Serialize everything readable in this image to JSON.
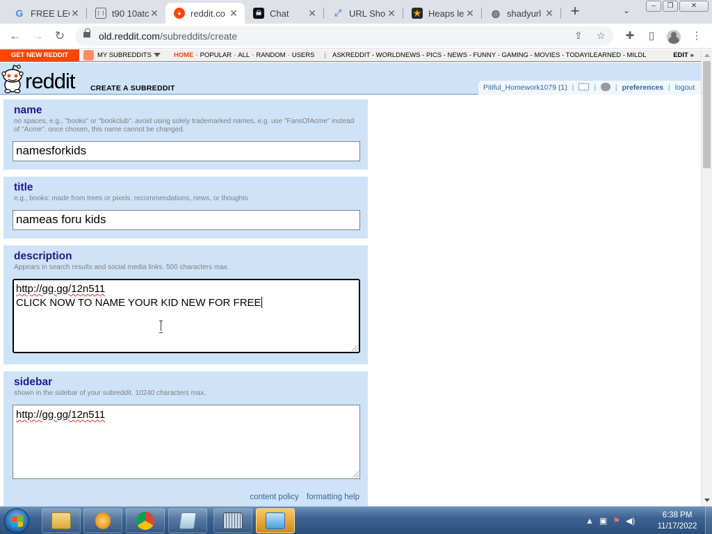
{
  "browser": {
    "tabs": [
      {
        "title": "FREE LEG",
        "favicon": "google-g"
      },
      {
        "title": "t90 10atc",
        "favicon": "generic-page"
      },
      {
        "title": "reddit.co",
        "favicon": "reddit-alien",
        "active": true
      },
      {
        "title": "Chat",
        "favicon": "pirate-flag"
      },
      {
        "title": "URL Shor",
        "favicon": "link"
      },
      {
        "title": "Heaps le",
        "favicon": "star"
      },
      {
        "title": "shadyurl",
        "favicon": "globe"
      }
    ],
    "url_domain": "old.reddit.com",
    "url_path": "/subreddits/create"
  },
  "reddit": {
    "srbar": {
      "get_new": "GET NEW REDDIT",
      "my_subreddits": "MY SUBREDDITS",
      "nav": [
        "HOME",
        "POPULAR",
        "ALL",
        "RANDOM",
        "USERS"
      ],
      "subs": "ASKREDDIT - WORLDNEWS - PICS - NEWS - FUNNY - GAMING - MOVIES - TODAYILEARNED - MILDL",
      "edit": "EDIT »"
    },
    "header": {
      "wordmark": "reddit",
      "pagename": "CREATE A SUBREDDIT",
      "username": "Pitiful_Homework1079",
      "karma": "(1)",
      "preferences": "preferences",
      "logout": "logout"
    },
    "form": {
      "name": {
        "label": "name",
        "hint": "no spaces, e.g., \"books\" or \"bookclub\". avoid using solely trademarked names, e.g. use \"FansOfAcme\" instead of \"Acme\". once chosen, this name cannot be changed.",
        "value": "namesforkids"
      },
      "title": {
        "label": "title",
        "hint": "e.g., books: made from trees or pixels. recommendations, news, or thoughts",
        "value": "nameas foru kids"
      },
      "description": {
        "label": "description",
        "hint": "Appears in search results and social media links. 500 characters max.",
        "line1": "http://gg.gg/12n511",
        "line2": "CLICK NOW TO NAME YOUR KID NEW FOR FREE"
      },
      "sidebar": {
        "label": "sidebar",
        "hint": "shown in the sidebar of your subreddit. 10240 characters max.",
        "line1": "http://gg.gg/12n511"
      },
      "content_policy": "content policy",
      "formatting_help": "formatting help"
    }
  },
  "taskbar": {
    "time": "6:38 PM",
    "date": "11/17/2022"
  },
  "colors": {
    "reddit_blue": "#cee3f8",
    "reddit_orange": "#ff4500",
    "label_blue": "#336"
  }
}
